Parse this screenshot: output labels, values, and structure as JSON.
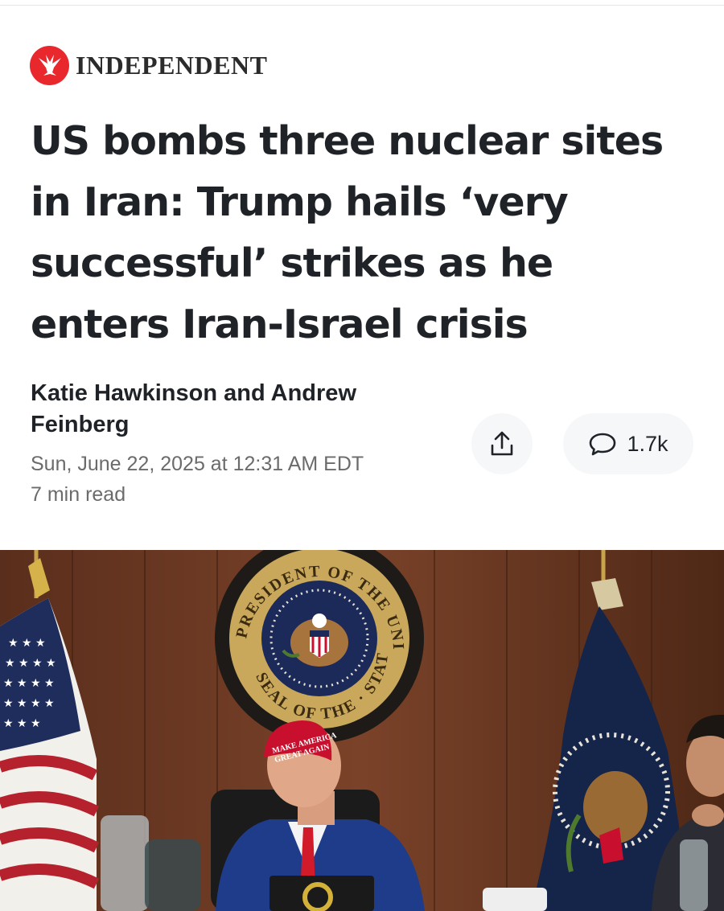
{
  "brand": {
    "name": "INDEPENDENT",
    "logo_icon": "eagle-logo-icon",
    "logo_color": "#e9282d"
  },
  "article": {
    "headline_lines": [
      "US bombs three nuclear sites",
      "in Iran: Trump hails ‘very",
      "successful’ strikes as he",
      "enters Iran-Israel crisis"
    ],
    "byline_lines": [
      "Katie Hawkinson and Andrew",
      "Feinberg"
    ],
    "date": "Sun, June 22, 2025 at 12:31 AM EDT",
    "read_time": "7 min read"
  },
  "actions": {
    "share_icon": "share-icon",
    "comment_icon": "comment-icon",
    "comment_count": "1.7k"
  },
  "image": {
    "seal_text_top": "PRESIDENT OF THE UNITED",
    "seal_text_bottom": "SEAL OF THE · STATES",
    "cap_text_line1": "MAKE AMERICA",
    "cap_text_line2": "GREAT AGAIN"
  }
}
